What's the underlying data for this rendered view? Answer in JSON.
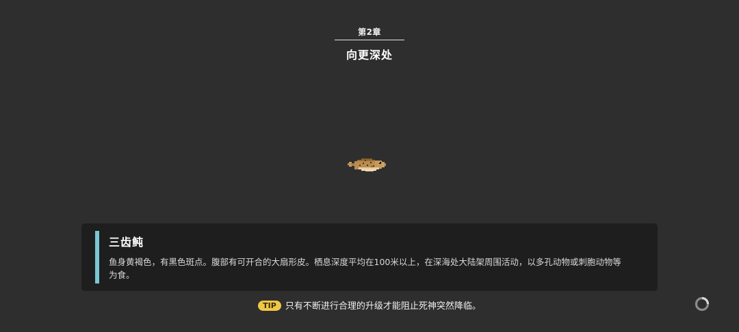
{
  "chapter": {
    "number": "第2章",
    "title": "向更深处"
  },
  "fish": {
    "icon": "pufferfish-icon"
  },
  "info_card": {
    "name": "三齿鲀",
    "description": "鱼身黄褐色，有黑色斑点。腹部有可开合的大扇形皮。栖息深度平均在100米以上，在深海处大陆架周围活动，以多孔动物或刺胞动物等为食。",
    "accent_color": "#78c6d6"
  },
  "tip": {
    "badge": "TIP",
    "text": "只有不断进行合理的升级才能阻止死神突然降临。"
  },
  "loading": {
    "icon": "loading-spinner-icon"
  },
  "colors": {
    "background": "#2e2e2e",
    "card": "#1e1e1e",
    "tip_badge": "#f0c848"
  }
}
